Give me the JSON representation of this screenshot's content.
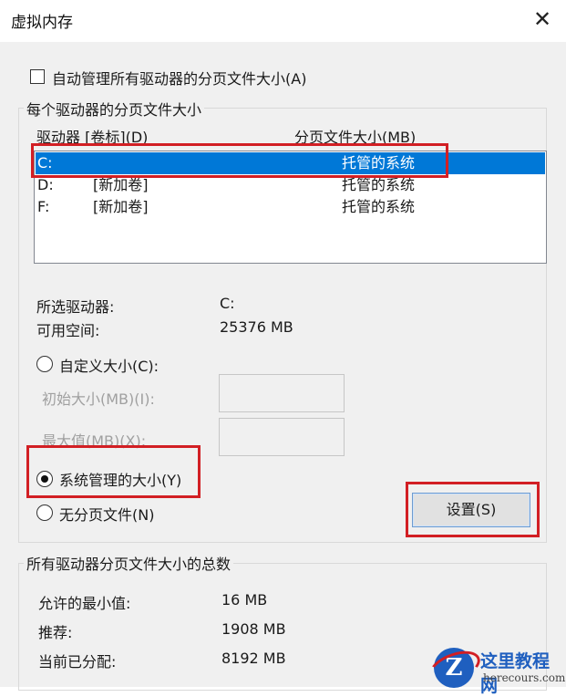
{
  "window": {
    "title": "虚拟内存",
    "close_glyph": "✕"
  },
  "auto_manage": {
    "label": "自动管理所有驱动器的分页文件大小(A)",
    "checked": false
  },
  "per_drive_group": {
    "title": "每个驱动器的分页文件大小",
    "columns": [
      "驱动器 [卷标](D)",
      "分页文件大小(MB)"
    ],
    "rows": [
      {
        "drive": "C:",
        "label": "",
        "size": "托管的系统",
        "selected": true
      },
      {
        "drive": "D:",
        "label": "[新加卷]",
        "size": "托管的系统",
        "selected": false
      },
      {
        "drive": "F:",
        "label": "[新加卷]",
        "size": "托管的系统",
        "selected": false
      }
    ],
    "selected_drive_label": "所选驱动器:",
    "selected_drive_value": "C:",
    "free_space_label": "可用空间:",
    "free_space_value": "25376 MB",
    "custom_size_label": "自定义大小(C):",
    "initial_size_label": "初始大小(MB)(I):",
    "max_size_label": "最大值(MB)(X):",
    "system_managed_label": "系统管理的大小(Y)",
    "no_paging_label": "无分页文件(N)",
    "selected_option": "system_managed",
    "set_button_label": "设置(S)"
  },
  "totals_group": {
    "title": "所有驱动器分页文件大小的总数",
    "min_allowed_label": "允许的最小值:",
    "min_allowed_value": "16 MB",
    "recommended_label": "推荐:",
    "recommended_value": "1908 MB",
    "current_label": "当前已分配:",
    "current_value": "8192 MB"
  },
  "watermark": {
    "name": "这里教程网",
    "url": "herecours.com",
    "logo_letter": "Z"
  },
  "colors": {
    "selection": "#0078d7",
    "highlight_box": "#d21f24",
    "dialog_bg": "#f0f0f0"
  }
}
